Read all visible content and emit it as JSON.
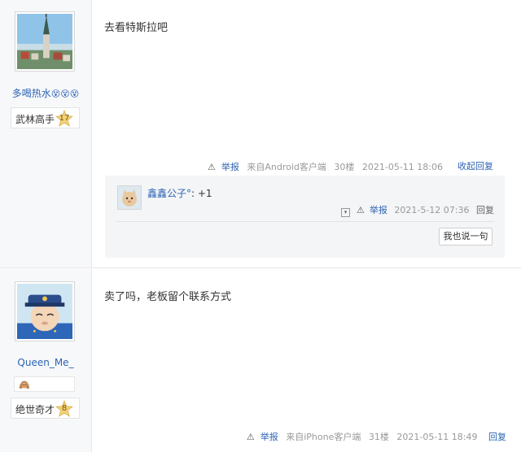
{
  "post1": {
    "username_text": "多喝热水",
    "username_emojis": "😵😵😵",
    "level_title": "武林高手",
    "level_number": "17",
    "content": "去看特斯拉吧",
    "report_label": "举报",
    "source": "来自Android客户端",
    "floor": "30楼",
    "time": "2021-05-11 18:06",
    "fold_label": "收起回复",
    "reply": {
      "user": "鑫鑫公子°",
      "text": ": +1",
      "report_label": "举报",
      "time": "2021-5-12 07:36",
      "reply_label": "回复",
      "say_button": "我也说一句"
    }
  },
  "post2": {
    "username": "Queen_Me_",
    "badge_icon": "🙈",
    "level_title": "绝世奇才",
    "level_number": "8",
    "content": "卖了吗，老板留个联系方式",
    "report_label": "举报",
    "source": "来自iPhone客户端",
    "floor": "31楼",
    "time": "2021-05-11 18:49",
    "reply_label": "回复"
  },
  "icons": {
    "warning": "⚠",
    "star_color": "#f3d27a",
    "link_color": "#2d64b3"
  }
}
